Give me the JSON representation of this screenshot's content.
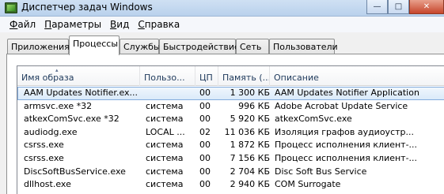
{
  "window": {
    "title": "Диспетчер задач Windows",
    "minimize_glyph": "—",
    "maximize_glyph": "□",
    "close_glyph": "✕"
  },
  "menu": [
    {
      "label": "Файл",
      "first": "Ф",
      "rest": "айл"
    },
    {
      "label": "Параметры",
      "first": "П",
      "rest": "араметры"
    },
    {
      "label": "Вид",
      "first": "В",
      "rest": "ид"
    },
    {
      "label": "Справка",
      "first": "С",
      "rest": "правка"
    }
  ],
  "tabs": [
    {
      "label": "Приложения",
      "active": false
    },
    {
      "label": "Процессы",
      "active": true
    },
    {
      "label": "Службы",
      "active": false
    },
    {
      "label": "Быстродействие",
      "active": false
    },
    {
      "label": "Сеть",
      "active": false
    },
    {
      "label": "Пользователи",
      "active": false
    }
  ],
  "columns": {
    "name": "Имя образа",
    "user": "Пользо...",
    "cpu": "ЦП",
    "memory": "Память (...",
    "description": "Описание",
    "sort_glyph": "▴"
  },
  "processes": [
    {
      "name": "AAM Updates Notifier.ex...",
      "user": "",
      "cpu": "00",
      "memory": "1 300 КБ",
      "description": "AAM Updates Notifier Application",
      "selected": true
    },
    {
      "name": "armsvc.exe *32",
      "user": "система",
      "cpu": "00",
      "memory": "996 КБ",
      "description": "Adobe Acrobat Update Service",
      "selected": false
    },
    {
      "name": "atkexComSvc.exe *32",
      "user": "система",
      "cpu": "00",
      "memory": "5 920 КБ",
      "description": "atkexComSvc.exe",
      "selected": false
    },
    {
      "name": "audiodg.exe",
      "user": "LOCAL ...",
      "cpu": "02",
      "memory": "11 036 КБ",
      "description": "Изоляция графов аудиоустр...",
      "selected": false
    },
    {
      "name": "csrss.exe",
      "user": "система",
      "cpu": "00",
      "memory": "1 872 КБ",
      "description": "Процесс исполнения клиент-...",
      "selected": false
    },
    {
      "name": "csrss.exe",
      "user": "система",
      "cpu": "00",
      "memory": "7 156 КБ",
      "description": "Процесс исполнения клиент-...",
      "selected": false
    },
    {
      "name": "DiscSoftBusService.exe",
      "user": "система",
      "cpu": "00",
      "memory": "2 704 КБ",
      "description": "Disc Soft Bus Service",
      "selected": false
    },
    {
      "name": "dllhost.exe",
      "user": "система",
      "cpu": "00",
      "memory": "2 940 КБ",
      "description": "COM Surrogate",
      "selected": false
    }
  ]
}
